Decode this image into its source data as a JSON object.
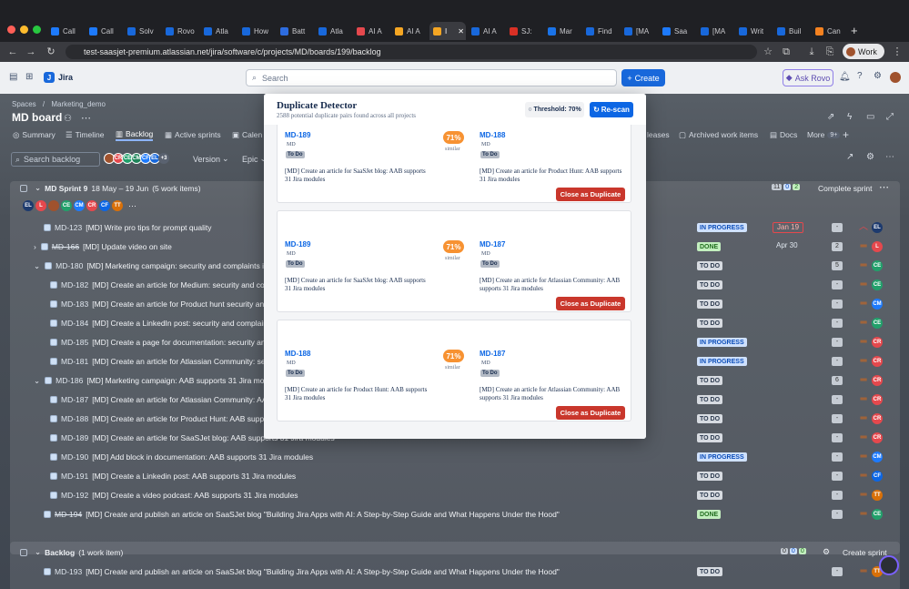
{
  "browser": {
    "tabs": [
      "Call",
      "Call",
      "Solv",
      "Rovo",
      "Atla",
      "How",
      "Batt",
      "Atla",
      "AI A",
      "AI A",
      "I",
      "AI A",
      "SJ:",
      "Mar",
      "Find",
      "[MA",
      "Saa",
      "[MA",
      "Writ",
      "Buil",
      "Can"
    ],
    "url": "test-saasjet-premium.atlassian.net/jira/software/c/projects/MD/boards/199/backlog",
    "work_label": "Work"
  },
  "jira_nav": {
    "brand": "Jira",
    "search_placeholder": "Search",
    "create_label": "Create",
    "rovo_label": "Ask Rovo"
  },
  "board": {
    "breadcrumb_spaces": "Spaces",
    "breadcrumb_sep": "/",
    "breadcrumb_project": "Marketing_demo",
    "title": "MD board",
    "nav": [
      "Summary",
      "Timeline",
      "Backlog",
      "Active sprints",
      "Calen"
    ],
    "nav_right": [
      "leases",
      "Archived work items",
      "Docs",
      "More"
    ],
    "more_count": "9+",
    "search_placeholder": "Search backlog",
    "avatar_more": "+3",
    "filter_version": "Version",
    "filter_epic": "Epic"
  },
  "sprint": {
    "checkbox": "",
    "name": "MD Sprint 9",
    "dates": "18 May – 19 Jun",
    "count": "(5 work items)",
    "counts": [
      "11",
      "0",
      "2"
    ],
    "complete_label": "Complete sprint"
  },
  "rows": [
    {
      "key": "MD-123",
      "title": "[MD] Write pro tips for prompt quality",
      "status": "IN PROGRESS",
      "due": "Jan 19",
      "est": "-",
      "indent": 0
    },
    {
      "key": "MD-166",
      "title": "[MD] Update video on site",
      "status": "DONE",
      "due": "Apr 30",
      "est": "2",
      "indent": 0,
      "done": true
    },
    {
      "key": "MD-180",
      "title": "[MD] Marketing campaign: security and complaints in A",
      "status": "TO DO",
      "est": "5",
      "indent": 0
    },
    {
      "key": "MD-182",
      "title": "[MD] Create an article for Medium: security and comp",
      "status": "TO DO",
      "est": "-",
      "indent": 1
    },
    {
      "key": "MD-183",
      "title": "[MD] Create an article for Product hunt security and c",
      "status": "TO DO",
      "est": "-",
      "indent": 1
    },
    {
      "key": "MD-184",
      "title": "[MD] Create a LinkedIn post: security and complaints",
      "status": "TO DO",
      "est": "-",
      "indent": 1
    },
    {
      "key": "MD-185",
      "title": "[MD] Create a page for documentation: security and c",
      "status": "IN PROGRESS",
      "est": "-",
      "indent": 1
    },
    {
      "key": "MD-181",
      "title": "[MD] Create an article for Atlassian Community: secur",
      "status": "IN PROGRESS",
      "est": "-",
      "indent": 1
    },
    {
      "key": "MD-186",
      "title": "[MD] Marketing campaign: AAB supports 31 Jira module",
      "status": "TO DO",
      "est": "6",
      "indent": 0
    },
    {
      "key": "MD-187",
      "title": "[MD] Create an article for Atlassian Community: AAB",
      "status": "TO DO",
      "est": "-",
      "indent": 1
    },
    {
      "key": "MD-188",
      "title": "[MD] Create an article for Product Hunt: AAB supports",
      "status": "TO DO",
      "est": "-",
      "indent": 1
    },
    {
      "key": "MD-189",
      "title": "[MD] Create an article for SaaSJet blog: AAB supports 31 Jira modules",
      "status": "TO DO",
      "est": "-",
      "indent": 1
    },
    {
      "key": "MD-190",
      "title": "[MD] Add block in documentation: AAB supports 31 Jira modules",
      "status": "IN PROGRESS",
      "est": "-",
      "indent": 1
    },
    {
      "key": "MD-191",
      "title": "[MD] Create a Linkedin post: AAB supports 31 Jira modules",
      "status": "TO DO",
      "est": "-",
      "indent": 1
    },
    {
      "key": "MD-192",
      "title": "[MD] Create a video podcast: AAB supports 31 Jira modules",
      "status": "TO DO",
      "est": "-",
      "indent": 1
    },
    {
      "key": "MD-194",
      "title": "[MD] Create and publish an article on SaaSJet blog \"Building Jira Apps with AI: A Step-by-Step Guide and What Happens Under the Hood\"",
      "status": "DONE",
      "est": "-",
      "indent": 0,
      "done": true
    }
  ],
  "backlog": {
    "name": "Backlog",
    "count": "(1 work item)",
    "counts": [
      "0",
      "0",
      "0"
    ],
    "create_label": "Create sprint",
    "row": {
      "key": "MD-193",
      "title": "[MD] Create and publish an article on SaaSJet blog \"Building Jira Apps with AI: A Step-by-Step Guide and What Happens Under the Hood\"",
      "status": "TO DO",
      "est": "-"
    }
  },
  "modal": {
    "title": "Duplicate Detector",
    "subtitle": "2588 potential duplicate pairs found across all projects",
    "threshold": "Threshold: 70%",
    "rescan": "Re-scan",
    "pairs": [
      {
        "a": {
          "key": "MD-189",
          "project": "MD",
          "status": "To Do",
          "desc": "[MD] Create an article for SaaSJet blog: AAB supports 31 Jira modules"
        },
        "b": {
          "key": "MD-188",
          "project": "MD",
          "status": "To Do",
          "desc": "[MD] Create an article for Product Hunt: AAB supports 31 Jira modules"
        },
        "score": "71%",
        "label": "similar",
        "action": "Close as Duplicate"
      },
      {
        "a": {
          "key": "MD-189",
          "project": "MD",
          "status": "To Do",
          "desc": "[MD] Create an article for SaaSJet blog: AAB supports 31 Jira modules"
        },
        "b": {
          "key": "MD-187",
          "project": "MD",
          "status": "To Do",
          "desc": "[MD] Create an article for Atlassian Community: AAB supports 31 Jira modules"
        },
        "score": "71%",
        "label": "similar",
        "action": "Close as Duplicate"
      },
      {
        "a": {
          "key": "MD-188",
          "project": "MD",
          "status": "To Do",
          "desc": "[MD] Create an article for Product Hunt: AAB supports 31 Jira modules"
        },
        "b": {
          "key": "MD-187",
          "project": "MD",
          "status": "To Do",
          "desc": "[MD] Create an article for Atlassian Community: AAB supports 31 Jira modules"
        },
        "score": "71%",
        "label": "similar",
        "action": "Close as Duplicate"
      }
    ]
  },
  "colors": {
    "brand": "#1868db",
    "danger": "#c9372c",
    "similar": "#f79232"
  },
  "icons": [
    "search-icon",
    "bell-icon",
    "help-icon",
    "gear-icon",
    "chevron-down-icon",
    "checkbox-icon",
    "priority-icon",
    "calendar-icon",
    "rescan-icon",
    "circle-icon"
  ]
}
